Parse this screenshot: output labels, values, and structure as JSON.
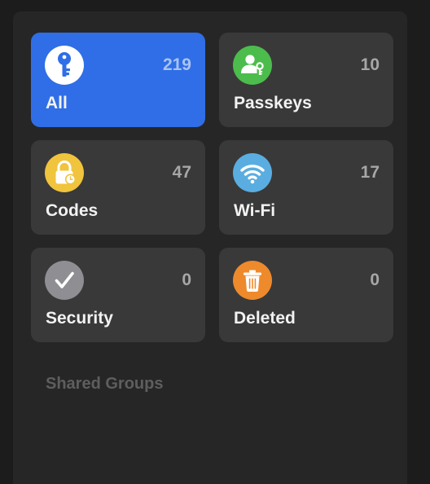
{
  "categories": [
    {
      "id": "all",
      "label": "All",
      "count": "219",
      "icon": "key-icon",
      "color": "#ffffff",
      "selected": true
    },
    {
      "id": "passkeys",
      "label": "Passkeys",
      "count": "10",
      "icon": "person-key-icon",
      "color": "#4cbc4c",
      "selected": false
    },
    {
      "id": "codes",
      "label": "Codes",
      "count": "47",
      "icon": "lock-clock-icon",
      "color": "#f0c43c",
      "selected": false
    },
    {
      "id": "wifi",
      "label": "Wi-Fi",
      "count": "17",
      "icon": "wifi-icon",
      "color": "#5aade0",
      "selected": false
    },
    {
      "id": "security",
      "label": "Security",
      "count": "0",
      "icon": "checkmark-icon",
      "color": "#8e8e93",
      "selected": false
    },
    {
      "id": "deleted",
      "label": "Deleted",
      "count": "0",
      "icon": "trash-icon",
      "color": "#ee8a2c",
      "selected": false
    }
  ],
  "shared_groups_header": "Shared Groups"
}
